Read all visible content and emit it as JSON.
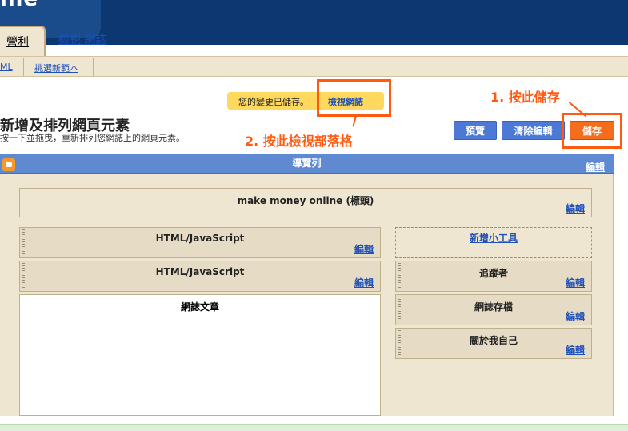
{
  "header": {
    "logo_text": "ine"
  },
  "tabs": {
    "active_label": "營利",
    "view_label": "檢視 網誌"
  },
  "subnav": {
    "items": [
      "ML",
      "挑選新範本"
    ]
  },
  "notice": {
    "message": "您的變更已儲存。",
    "link": "檢視網誌"
  },
  "annotations": {
    "step1": "1. 按此儲存",
    "step2": "2. 按此檢視部落格"
  },
  "page": {
    "title": "新增及排列網頁元素",
    "subtitle": "按一下並拖曳，重新排列您網誌上的網頁元素。"
  },
  "buttons": {
    "preview": "預覽",
    "clear_edit": "清除編輯",
    "save": "儲存"
  },
  "layout": {
    "navbar": {
      "title": "導覽列",
      "edit": "編輯"
    },
    "header_gadget": {
      "title": "make money online (標頭)",
      "edit": "編輯"
    },
    "left_gadgets": [
      {
        "title": "HTML/JavaScript",
        "edit": "編輯"
      },
      {
        "title": "HTML/JavaScript",
        "edit": "編輯"
      }
    ],
    "blog_posts": {
      "title": "網誌文章"
    },
    "add_gadget": "新增小工具",
    "right_gadgets": [
      {
        "title": "追蹤者",
        "edit": "編輯"
      },
      {
        "title": "網誌存檔",
        "edit": "編輯"
      },
      {
        "title": "關於我自己",
        "edit": "編輯"
      }
    ]
  },
  "colors": {
    "accent": "#ff5a10",
    "header_bg": "#0c3770",
    "panel_bg": "#efe6d1",
    "button_blue": "#4d79d6",
    "save_orange": "#f36d1c"
  }
}
